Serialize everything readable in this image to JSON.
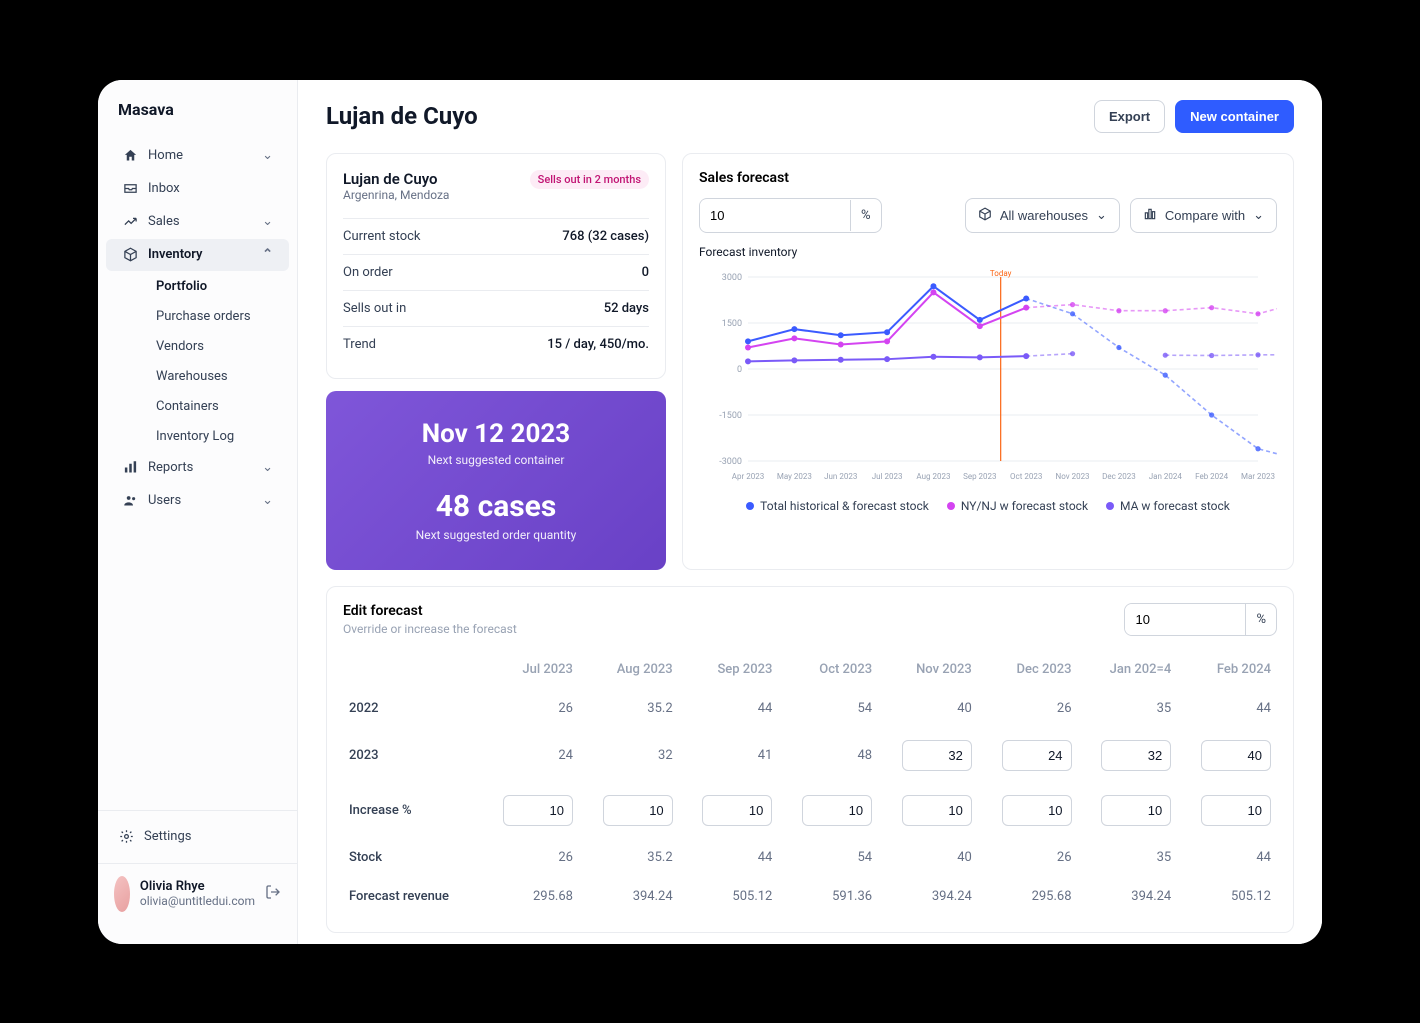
{
  "brand": "Masava",
  "nav": {
    "home": "Home",
    "inbox": "Inbox",
    "sales": "Sales",
    "inventory": "Inventory",
    "inventory_sub": {
      "portfolio": "Portfolio",
      "purchase_orders": "Purchase orders",
      "vendors": "Vendors",
      "warehouses": "Warehouses",
      "containers": "Containers",
      "inventory_log": "Inventory Log"
    },
    "reports": "Reports",
    "users": "Users",
    "settings": "Settings"
  },
  "user": {
    "name": "Olivia Rhye",
    "email": "olivia@untitledui.com"
  },
  "header": {
    "title": "Lujan de Cuyo",
    "export": "Export",
    "new_container": "New container"
  },
  "summary": {
    "title": "Lujan de Cuyo",
    "region": "Argenrina, Mendoza",
    "pill": "Sells out in 2 months",
    "rows": {
      "current_stock_l": "Current stock",
      "current_stock_v": "768 (32 cases)",
      "on_order_l": "On order",
      "on_order_v": "0",
      "sells_out_l": "Sells out in",
      "sells_out_v": "52 days",
      "trend_l": "Trend",
      "trend_v": "15 / day, 450/mo."
    }
  },
  "suggest": {
    "date": "Nov 12 2023",
    "date_label": "Next suggested container",
    "qty": "48 cases",
    "qty_label": "Next suggested order quantity"
  },
  "forecast": {
    "title": "Sales forecast",
    "pct_value": "10",
    "pct_unit": "%",
    "warehouse_btn": "All warehouses",
    "compare_btn": "Compare with",
    "subtitle": "Forecast inventory",
    "today_label": "Today",
    "legend": {
      "a": "Total historical & forecast stock",
      "b": "NY/NJ w forecast stock",
      "c": "MA w forecast stock"
    }
  },
  "edit": {
    "title": "Edit forecast",
    "sub": "Override or increase the forecast",
    "pct_value": "10",
    "pct_unit": "%",
    "months": [
      "Jul 2023",
      "Aug 2023",
      "Sep 2023",
      "Oct 2023",
      "Nov 2023",
      "Dec 2023",
      "Jan 202=4",
      "Feb 2024"
    ],
    "rows": {
      "y2022_label": "2022",
      "y2022": [
        "26",
        "35.2",
        "44",
        "54",
        "40",
        "26",
        "35",
        "44"
      ],
      "y2023_label": "2023",
      "y2023_static": [
        "24",
        "32",
        "41",
        "48"
      ],
      "y2023_editable": [
        "32",
        "24",
        "32",
        "40"
      ],
      "inc_label": "Increase %",
      "inc": [
        "10",
        "10",
        "10",
        "10",
        "10",
        "10",
        "10",
        "10"
      ],
      "stock_label": "Stock",
      "stock": [
        "26",
        "35.2",
        "44",
        "54",
        "40",
        "26",
        "35",
        "44"
      ],
      "rev_label": "Forecast revenue",
      "rev": [
        "295.68",
        "394.24",
        "505.12",
        "591.36",
        "394.24",
        "295.68",
        "394.24",
        "505.12"
      ]
    }
  },
  "chart_data": {
    "type": "line",
    "xlabel": "",
    "ylabel": "",
    "ylim": [
      -3000,
      3000
    ],
    "y_ticks": [
      3000,
      1500,
      0,
      -1500,
      -3000
    ],
    "categories": [
      "Apr 2023",
      "May 2023",
      "Jun 2023",
      "Jul 2023",
      "Aug 2023",
      "Sep 2023",
      "Oct 2023",
      "Nov 2023",
      "Dec 2023",
      "Jan 2024",
      "Feb 2024",
      "Mar 2023"
    ],
    "today_index": 5,
    "series": [
      {
        "name": "Total historical & forecast stock",
        "color": "#3b5bff",
        "solid_values": [
          900,
          1300,
          1100,
          1200,
          2700,
          1600,
          2300
        ],
        "dashed_values": [
          2300,
          1800,
          700,
          -200,
          -1500,
          -2600,
          -3000
        ]
      },
      {
        "name": "NY/NJ w forecast stock",
        "color": "#d444f1",
        "solid_values": [
          700,
          1000,
          800,
          900,
          2500,
          1400,
          2000
        ],
        "dashed_values": [
          2000,
          2100,
          1900,
          1900,
          2000,
          1800,
          2200
        ]
      },
      {
        "name": "MA w forecast stock",
        "color": "#7a5af8",
        "solid_values": [
          250,
          280,
          300,
          320,
          400,
          380,
          420
        ],
        "dashed_values": [
          420,
          500,
          null,
          450,
          440,
          460,
          470
        ]
      }
    ]
  }
}
